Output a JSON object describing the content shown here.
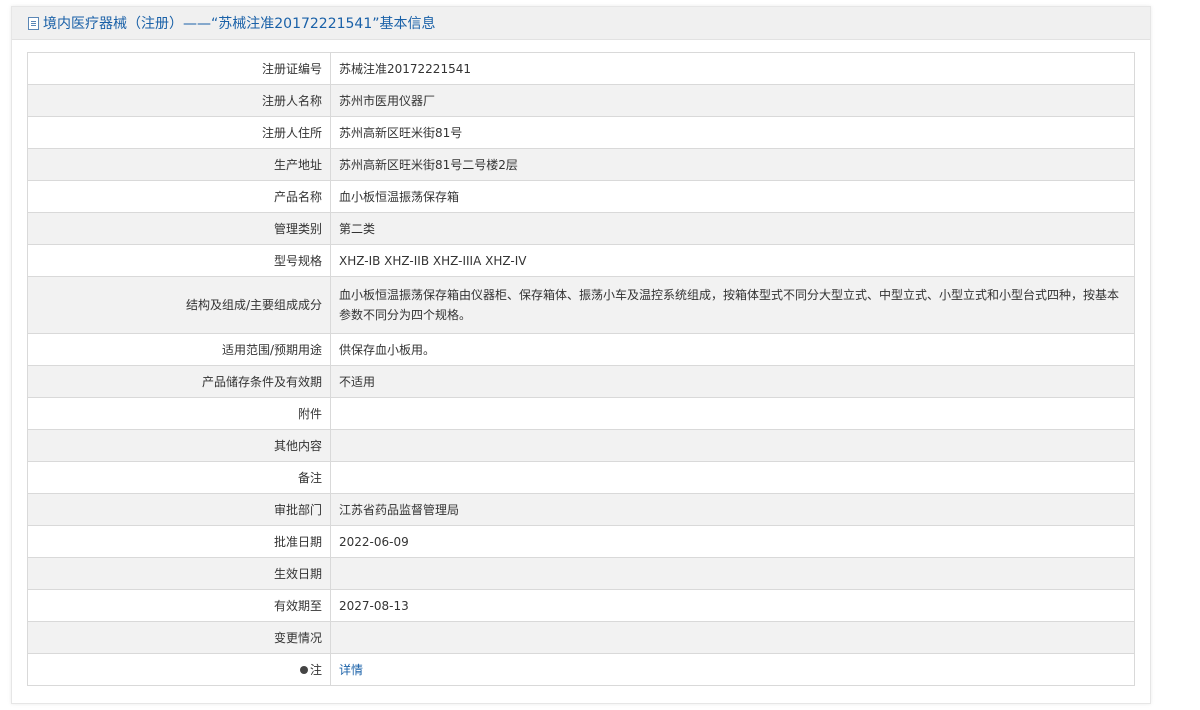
{
  "header": {
    "title": "境内医疗器械（注册）——“苏械注准20172221541”基本信息",
    "icon": "document-icon"
  },
  "rows": [
    {
      "label": "注册证编号",
      "value": "苏械注准20172221541"
    },
    {
      "label": "注册人名称",
      "value": "苏州市医用仪器厂"
    },
    {
      "label": "注册人住所",
      "value": "苏州高新区旺米街81号"
    },
    {
      "label": "生产地址",
      "value": "苏州高新区旺米街81号二号楼2层"
    },
    {
      "label": "产品名称",
      "value": "血小板恒温振荡保存箱"
    },
    {
      "label": "管理类别",
      "value": "第二类"
    },
    {
      "label": "型号规格",
      "value": "XHZ-IB XHZ-IIB XHZ-IIIA XHZ-IV"
    },
    {
      "label": "结构及组成/主要组成成分",
      "value": "血小板恒温振荡保存箱由仪器柜、保存箱体、振荡小车及温控系统组成，按箱体型式不同分大型立式、中型立式、小型立式和小型台式四种，按基本参数不同分为四个规格。"
    },
    {
      "label": "适用范围/预期用途",
      "value": "供保存血小板用。"
    },
    {
      "label": "产品储存条件及有效期",
      "value": "不适用"
    },
    {
      "label": "附件",
      "value": ""
    },
    {
      "label": "其他内容",
      "value": ""
    },
    {
      "label": "备注",
      "value": ""
    },
    {
      "label": "审批部门",
      "value": "江苏省药品监督管理局"
    },
    {
      "label": "批准日期",
      "value": "2022-06-09"
    },
    {
      "label": "生效日期",
      "value": ""
    },
    {
      "label": "有效期至",
      "value": "2027-08-13"
    },
    {
      "label": "变更情况",
      "value": ""
    },
    {
      "label": "注",
      "value": "详情",
      "icon": "bulb-icon"
    }
  ],
  "colors": {
    "accent": "#1a61a8",
    "header_bg": "#f0f0f0",
    "row_alt_bg": "#f2f2f2",
    "border": "#d9d9d9"
  }
}
